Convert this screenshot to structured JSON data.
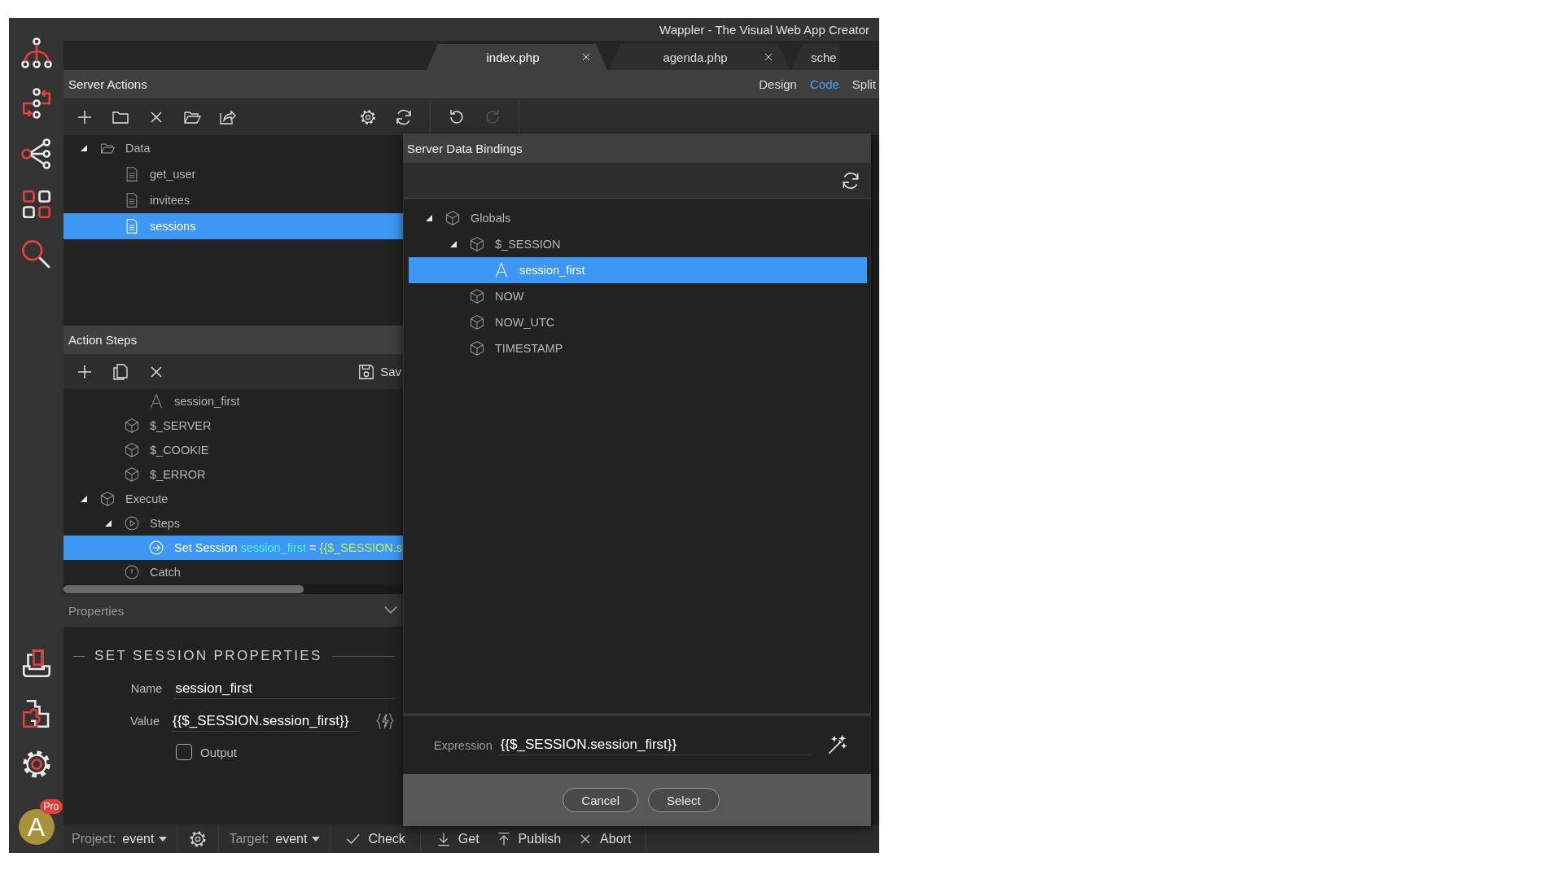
{
  "window": {
    "title": "Wappler - The Visual Web App Creator"
  },
  "tabs": [
    {
      "label": "index.php",
      "selected": true,
      "closable": true
    },
    {
      "label": "agenda.php",
      "selected": false,
      "closable": true
    },
    {
      "label": "sche",
      "selected": false,
      "closable": false
    }
  ],
  "view_modes": [
    {
      "label": "Design",
      "selected": false
    },
    {
      "label": "Code",
      "selected": true
    },
    {
      "label": "Split",
      "selected": false
    }
  ],
  "server_actions": {
    "title": "Server Actions",
    "tree": [
      {
        "label": "Data",
        "kind": "folder",
        "expanded": true,
        "selected": false,
        "children": [
          {
            "label": "get_user",
            "kind": "file",
            "selected": false
          },
          {
            "label": "invitees",
            "kind": "file",
            "selected": false
          },
          {
            "label": "sessions",
            "kind": "file",
            "selected": true
          }
        ]
      }
    ]
  },
  "action_steps": {
    "title": "Action Steps",
    "save_label": "Sav",
    "tree": [
      {
        "children": [
          {
            "children": [
              {
                "label": "session_first",
                "kind": "text",
                "selected": false
              }
            ]
          },
          {
            "label": "$_SERVER",
            "kind": "object",
            "selected": false
          },
          {
            "label": "$_COOKIE",
            "kind": "object",
            "selected": false
          },
          {
            "label": "$_ERROR",
            "kind": "object",
            "selected": false
          }
        ]
      },
      {
        "label": "Execute",
        "kind": "object",
        "expanded": true,
        "selected": false,
        "children": [
          {
            "label": "Steps",
            "kind": "steps",
            "expanded": true,
            "selected": false,
            "children": [
              {
                "label": "Set Session",
                "kind": "action",
                "selected": true,
                "detail_name": "session_first",
                "detail_op": "=",
                "detail_value": "{{$_SESSION.s"
              }
            ]
          },
          {
            "label": "Catch",
            "kind": "catch",
            "selected": false
          }
        ]
      }
    ]
  },
  "properties": {
    "title": "Properties",
    "section_title": "SET SESSION PROPERTIES",
    "fields": [
      {
        "label": "Name",
        "value": "session_first",
        "kind": "text"
      },
      {
        "label": "Value",
        "value": "{{$_SESSION.session_first}}",
        "kind": "expression"
      }
    ],
    "checkbox": {
      "label": "Output",
      "checked": false
    }
  },
  "dialog": {
    "title": "Server Data Bindings",
    "tree": [
      {
        "label": "Globals",
        "kind": "object",
        "expanded": true,
        "selected": false,
        "children": [
          {
            "label": "$_SESSION",
            "kind": "object",
            "expanded": true,
            "selected": false,
            "children": [
              {
                "label": "session_first",
                "kind": "text",
                "selected": true
              }
            ]
          },
          {
            "label": "NOW",
            "kind": "object",
            "selected": false
          },
          {
            "label": "NOW_UTC",
            "kind": "object",
            "selected": false
          },
          {
            "label": "TIMESTAMP",
            "kind": "object",
            "selected": false
          }
        ]
      }
    ],
    "expression_label": "Expression",
    "expression_value": "{{$_SESSION.session_first}}",
    "buttons": [
      "Cancel",
      "Select"
    ]
  },
  "user": {
    "initial": "A",
    "badge": "Pro"
  },
  "status_bar": {
    "project_label": "Project:",
    "project_value": "event",
    "target_label": "Target:",
    "target_value": "event",
    "actions": [
      {
        "label": "Check",
        "kind": "check"
      },
      {
        "label": "Get",
        "kind": "download"
      },
      {
        "label": "Publish",
        "kind": "upload"
      },
      {
        "label": "Abort",
        "kind": "abort"
      }
    ]
  }
}
